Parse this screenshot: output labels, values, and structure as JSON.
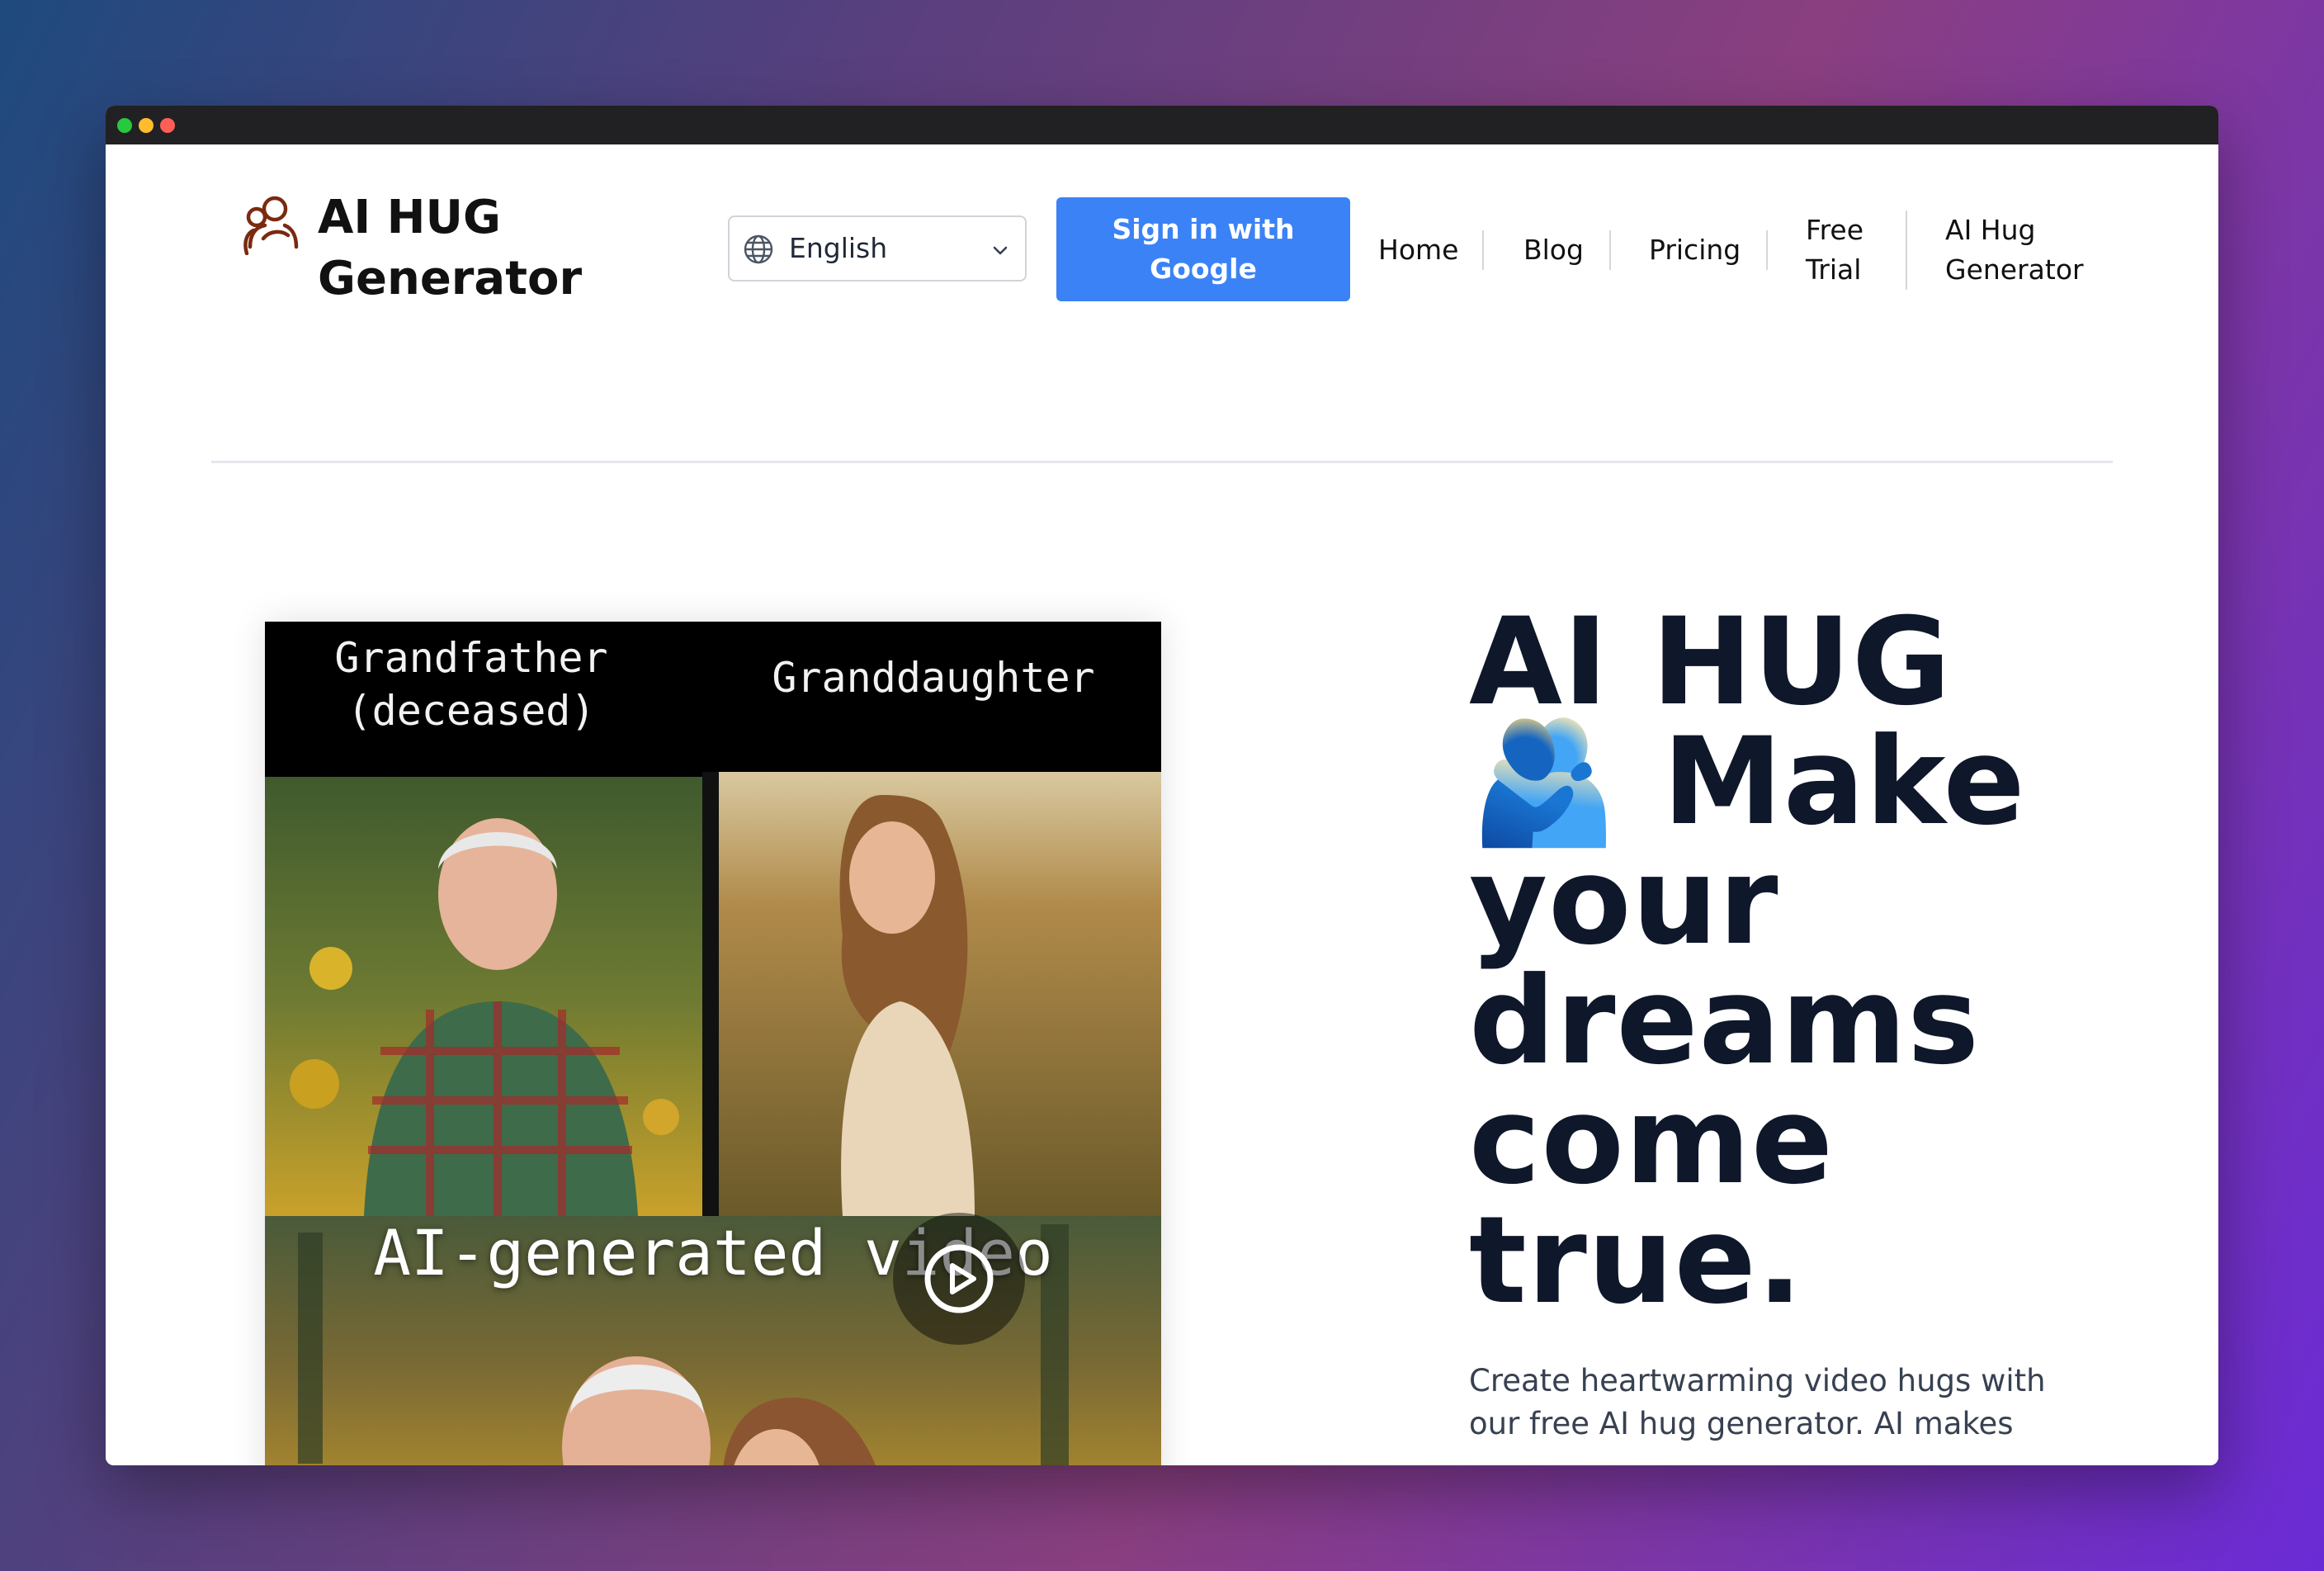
{
  "window": {
    "controls": [
      "close",
      "minimize",
      "maximize"
    ]
  },
  "brand": {
    "logo_icon": "hug-person-icon",
    "name": "AI HUG Generator",
    "icon_color": "#7a2a10"
  },
  "header": {
    "language": {
      "icon": "globe-icon",
      "selected": "English"
    },
    "signin_label": "Sign in with Google",
    "signin_color": "#3b82f6",
    "nav": [
      {
        "label": "Home"
      },
      {
        "label": "Blog"
      },
      {
        "label": "Pricing"
      },
      {
        "label": "Free Trial"
      },
      {
        "label": "AI Hug Generator"
      }
    ]
  },
  "hero": {
    "media": {
      "caption_left": "Grandfather (deceased)",
      "caption_right": "Granddaughter",
      "caption_bottom": "AI-generated video",
      "play_icon": "play-icon"
    },
    "headline": "AI HUG 🫂 Make your dreams come true.",
    "subtext": "Create heartwarming video hugs with our free AI hug generator. AI makes"
  }
}
